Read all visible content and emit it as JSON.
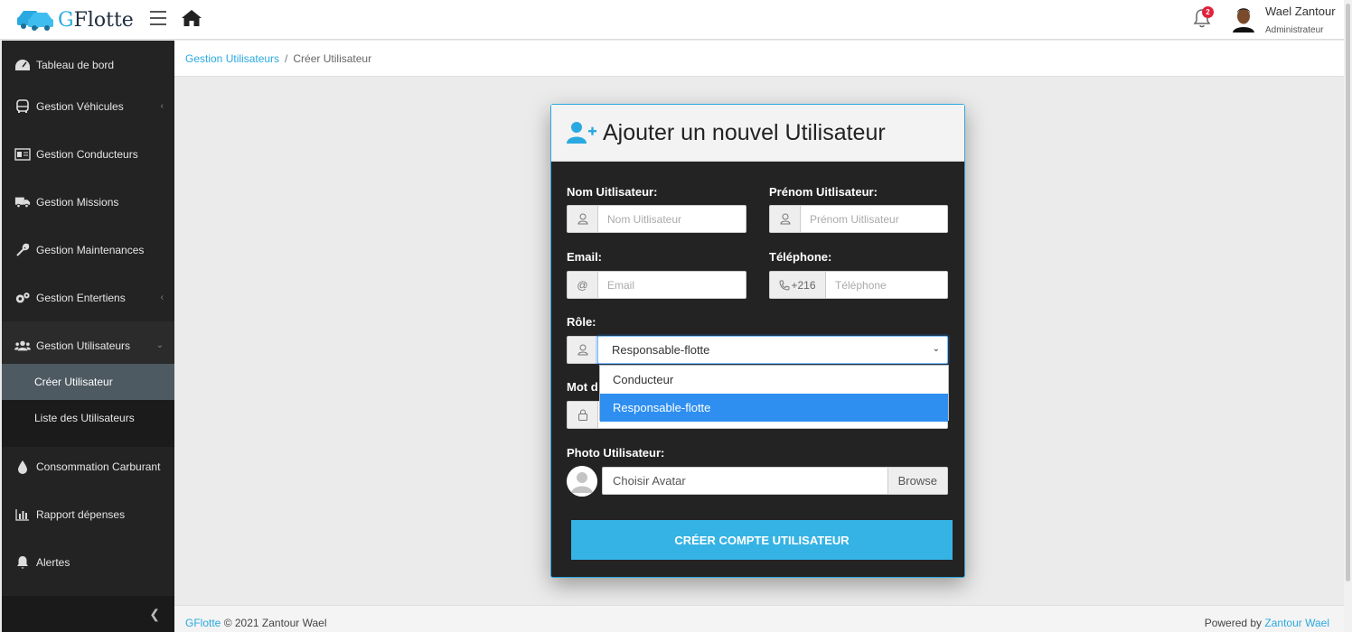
{
  "app": {
    "brand": "GFlotte",
    "brand_first_letter": "G",
    "brand_rest": "Flotte"
  },
  "header": {
    "notifications_count": "2",
    "user_name": "Wael Zantour",
    "user_role": "Administrateur"
  },
  "sidebar": {
    "items": [
      {
        "label": "Tableau de bord",
        "icon": "dashboard-icon"
      },
      {
        "label": "Gestion Véhicules",
        "icon": "bus-icon"
      },
      {
        "label": "Gestion Conducteurs",
        "icon": "id-card-icon"
      },
      {
        "label": "Gestion Missions",
        "icon": "truck-icon"
      },
      {
        "label": "Gestion Maintenances",
        "icon": "wrench-icon"
      },
      {
        "label": "Gestion Entertiens",
        "icon": "gears-icon"
      },
      {
        "label": "Gestion Utilisateurs",
        "icon": "users-icon"
      },
      {
        "label": "Consommation Carburant",
        "icon": "drop-icon"
      },
      {
        "label": "Rapport dépenses",
        "icon": "bar-chart-icon"
      },
      {
        "label": "Alertes",
        "icon": "bell-icon"
      }
    ],
    "subitems": [
      {
        "label": "Créer Utilisateur"
      },
      {
        "label": "Liste des Utilisateurs"
      }
    ]
  },
  "breadcrumb": {
    "parent": "Gestion Utilisateurs",
    "separator": "/",
    "current": "Créer Utilisateur"
  },
  "form": {
    "title": "Ajouter un nouvel Utilisateur",
    "nom_label": "Nom Uitlisateur:",
    "nom_placeholder": "Nom Uitlisateur",
    "prenom_label": "Prénom Uitlisateur:",
    "prenom_placeholder": "Prénom Uitlisateur",
    "email_label": "Email:",
    "email_addon": "@",
    "email_placeholder": "Email",
    "tel_label": "Téléphone:",
    "tel_prefix": "+216",
    "tel_placeholder": "Téléphone",
    "role_label": "Rôle:",
    "role_selected": "Responsable-flotte",
    "role_options": [
      "Conducteur",
      "Responsable-flotte"
    ],
    "password_label_partial": "Mot d",
    "photo_label": "Photo Utilisateur:",
    "file_placeholder": "Choisir Avatar",
    "browse_label": "Browse",
    "submit_label": "CRÉER COMPTE UTILISATEUR"
  },
  "footer": {
    "brand_link": "GFlotte",
    "copyright": "© 2021 Zantour Wael",
    "powered_by": "Powered by",
    "powered_link": "Zantour Wael"
  },
  "colors": {
    "accent": "#2aa9e0",
    "sidebar_bg": "#232323",
    "submit_bg": "#35b3e4",
    "selected_option": "#2e8ff0",
    "badge": "#e0223b"
  }
}
